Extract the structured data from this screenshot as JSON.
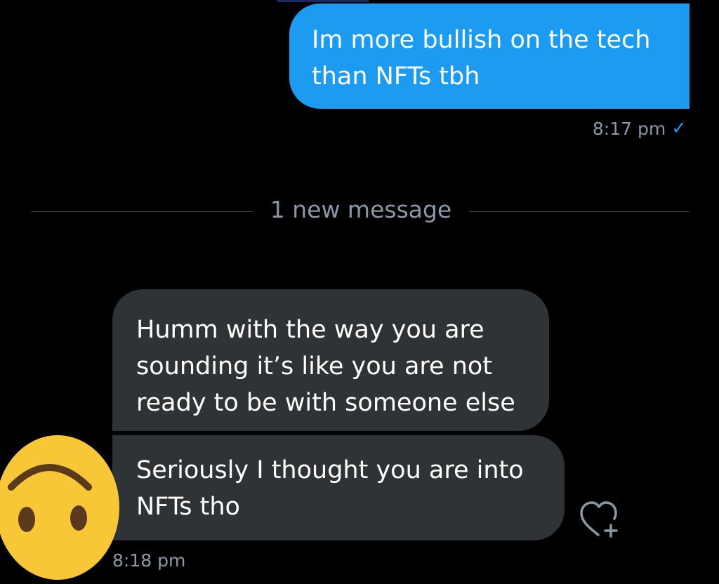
{
  "conversation": {
    "outgoing": {
      "text": "Im more bullish on the tech\nthan NFTs tbh",
      "time": "8:17 pm",
      "status_icon": "check-icon"
    },
    "divider": {
      "label": "1 new message"
    },
    "incoming": [
      {
        "text": "Humm with the way you are\nsounding it’s like you are not\nready to be with someone else"
      },
      {
        "text": "Seriously I thought you are into\nNFTs tho"
      }
    ],
    "incoming_time": "8:18 pm",
    "reaction_icon": "heart-plus-icon",
    "avatar_icon": "upside-down-face-emoji-icon"
  },
  "colors": {
    "background": "#000000",
    "outgoing_bubble": "#1d9bf0",
    "incoming_bubble": "#2f3336",
    "meta_text": "#8b98a5",
    "accent": "#1d9bf0",
    "emoji": "#f7c738"
  }
}
